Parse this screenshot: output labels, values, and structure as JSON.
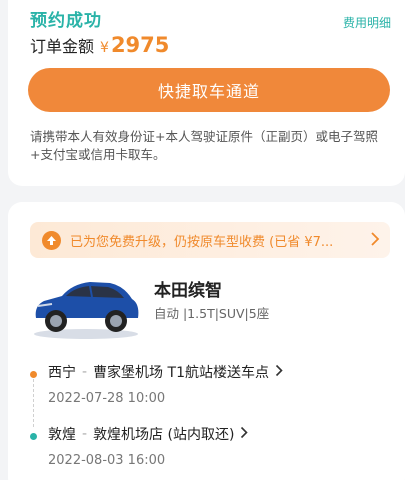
{
  "booking": {
    "status": "预约成功",
    "fee_detail_link": "费用明细",
    "amount_label": "订单金额",
    "currency": "¥",
    "amount": "2975",
    "quick_pickup_button": "快捷取车通道",
    "notice": "请携带本人有效身份证+本人驾驶证原件（正副页）或电子驾照+支付宝或信用卡取车。"
  },
  "upgrade_banner": {
    "text": "已为您免费升级，仍按原车型收费 (已省 ¥7..."
  },
  "car": {
    "name": "本田缤智",
    "specs": "自动 |1.5T|SUV|5座"
  },
  "pickup": {
    "city": "西宁",
    "location": "曹家堡机场 T1航站楼送车点",
    "datetime": "2022-07-28 10:00"
  },
  "return": {
    "city": "敦煌",
    "location": "敦煌机场店 (站内取还)",
    "datetime": "2022-08-03 16:00"
  },
  "colors": {
    "teal": "#2ab3a8",
    "orange": "#f08a2c"
  }
}
